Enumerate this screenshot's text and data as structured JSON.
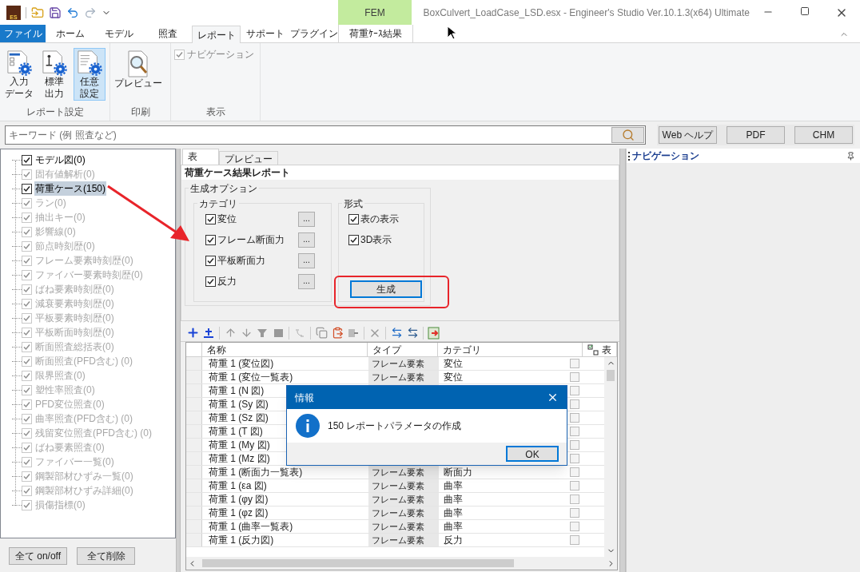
{
  "window": {
    "logo": "ES",
    "context_label": "FEM",
    "title": "BoxCulvert_LoadCase_LSD.esx - Engineer's Studio Ver.10.1.3(x64) Ultimate"
  },
  "ribbon_tabs": [
    {
      "label": "ファイル",
      "kind": "file",
      "selected": false
    },
    {
      "label": "ホーム",
      "kind": "tab",
      "selected": false
    },
    {
      "label": "モデル",
      "kind": "tab",
      "selected": false
    },
    {
      "label": "照査",
      "kind": "tab",
      "selected": false
    },
    {
      "label": "レポート",
      "kind": "tab",
      "selected": true
    },
    {
      "label": "サポート",
      "kind": "tab",
      "selected": false
    },
    {
      "label": "プラグイン",
      "kind": "tab",
      "selected": false
    },
    {
      "label": "荷重ｹｰｽ結果",
      "kind": "context",
      "selected": false
    }
  ],
  "ribbon_groups": [
    {
      "label": "レポート設定",
      "items": [
        {
          "kind": "large",
          "lines": [
            "入力",
            "データ"
          ],
          "selected": false
        },
        {
          "kind": "large",
          "lines": [
            "標準",
            "出力"
          ],
          "selected": false
        },
        {
          "kind": "large",
          "lines": [
            "任意",
            "設定"
          ],
          "selected": true
        }
      ]
    },
    {
      "label": "印刷",
      "items": [
        {
          "kind": "large",
          "lines": [
            "プレビュー"
          ],
          "selected": false
        }
      ]
    },
    {
      "label": "表示",
      "items": [
        {
          "kind": "check",
          "label": "ナビゲーション",
          "checked": true,
          "disabled": true
        }
      ]
    }
  ],
  "search": {
    "placeholder": "キーワード (例 照査など)"
  },
  "help_buttons": [
    "Web ヘルプ",
    "PDF",
    "CHM"
  ],
  "tree": [
    {
      "label": "モデル図(0)",
      "checked": true,
      "disabled": false,
      "selected": false
    },
    {
      "label": "固有値解析(0)",
      "checked": true,
      "disabled": true,
      "selected": false
    },
    {
      "label": "荷重ケース(150)",
      "checked": true,
      "disabled": false,
      "selected": true
    },
    {
      "label": "ラン(0)",
      "checked": true,
      "disabled": true,
      "selected": false
    },
    {
      "label": "抽出キー(0)",
      "checked": true,
      "disabled": true,
      "selected": false
    },
    {
      "label": "影響線(0)",
      "checked": true,
      "disabled": true,
      "selected": false
    },
    {
      "label": "節点時刻歴(0)",
      "checked": true,
      "disabled": true,
      "selected": false
    },
    {
      "label": "フレーム要素時刻歴(0)",
      "checked": true,
      "disabled": true,
      "selected": false
    },
    {
      "label": "ファイバー要素時刻歴(0)",
      "checked": true,
      "disabled": true,
      "selected": false
    },
    {
      "label": "ばね要素時刻歴(0)",
      "checked": true,
      "disabled": true,
      "selected": false
    },
    {
      "label": "減衰要素時刻歴(0)",
      "checked": true,
      "disabled": true,
      "selected": false
    },
    {
      "label": "平板要素時刻歴(0)",
      "checked": true,
      "disabled": true,
      "selected": false
    },
    {
      "label": "平板断面時刻歴(0)",
      "checked": true,
      "disabled": true,
      "selected": false
    },
    {
      "label": "断面照査総括表(0)",
      "checked": true,
      "disabled": true,
      "selected": false
    },
    {
      "label": "断面照査(PFD含む) (0)",
      "checked": true,
      "disabled": true,
      "selected": false
    },
    {
      "label": "限界照査(0)",
      "checked": true,
      "disabled": true,
      "selected": false
    },
    {
      "label": "塑性率照査(0)",
      "checked": true,
      "disabled": true,
      "selected": false
    },
    {
      "label": "PFD変位照査(0)",
      "checked": true,
      "disabled": true,
      "selected": false
    },
    {
      "label": "曲率照査(PFD含む) (0)",
      "checked": true,
      "disabled": true,
      "selected": false
    },
    {
      "label": "残留変位照査(PFD含む) (0)",
      "checked": true,
      "disabled": true,
      "selected": false
    },
    {
      "label": "ばね要素照査(0)",
      "checked": true,
      "disabled": true,
      "selected": false
    },
    {
      "label": "ファイバー一覧(0)",
      "checked": true,
      "disabled": true,
      "selected": false
    },
    {
      "label": "鋼製部材ひずみ一覧(0)",
      "checked": true,
      "disabled": true,
      "selected": false
    },
    {
      "label": "鋼製部材ひずみ詳細(0)",
      "checked": true,
      "disabled": true,
      "selected": false
    },
    {
      "label": "損傷指標(0)",
      "checked": true,
      "disabled": true,
      "selected": false
    }
  ],
  "tree_buttons": [
    "全て on/off",
    "全て削除"
  ],
  "center_tabs": [
    {
      "label": "表",
      "selected": true
    },
    {
      "label": "プレビュー",
      "selected": false
    }
  ],
  "report": {
    "title": "荷重ケース結果レポート",
    "options_label": "生成オプション",
    "category": {
      "label": "カテゴリ",
      "items": [
        {
          "label": "変位",
          "checked": true,
          "button": "..."
        },
        {
          "label": "フレーム断面力",
          "checked": true,
          "button": "..."
        },
        {
          "label": "平板断面力",
          "checked": true,
          "button": "..."
        },
        {
          "label": "反力",
          "checked": true,
          "button": "..."
        }
      ]
    },
    "format": {
      "label": "形式",
      "items": [
        {
          "label": "表の表示",
          "checked": true
        },
        {
          "label": "3D表示",
          "checked": true
        }
      ]
    },
    "generate_button": "生成"
  },
  "table": {
    "columns": [
      "名称",
      "タイプ",
      "カテゴリ",
      "表"
    ],
    "rows": [
      {
        "name": "荷重 1 (変位図)",
        "type": "フレーム要素",
        "category": "変位"
      },
      {
        "name": "荷重 1 (変位一覧表)",
        "type": "フレーム要素",
        "category": "変位"
      },
      {
        "name": "荷重 1 (N 図)"
      },
      {
        "name": "荷重 1 (Sy 図)"
      },
      {
        "name": "荷重 1 (Sz 図)"
      },
      {
        "name": "荷重 1 (T 図)"
      },
      {
        "name": "荷重 1 (My 図)"
      },
      {
        "name": "荷重 1 (Mz 図)"
      },
      {
        "name": "荷重 1 (断面力一覧表)",
        "type": "フレーム要素",
        "category": "断面力"
      },
      {
        "name": "荷重 1 (εa 図)",
        "type": "フレーム要素",
        "category": "曲率"
      },
      {
        "name": "荷重 1 (φy 図)",
        "type": "フレーム要素",
        "category": "曲率"
      },
      {
        "name": "荷重 1 (φz 図)",
        "type": "フレーム要素",
        "category": "曲率"
      },
      {
        "name": "荷重 1 (曲率一覧表)",
        "type": "フレーム要素",
        "category": "曲率"
      },
      {
        "name": "荷重 1 (反力図)",
        "type": "フレーム要素",
        "category": "反力"
      }
    ]
  },
  "dialog": {
    "title": "情報",
    "message": "150 レポートパラメータの作成",
    "button": "OK"
  },
  "navigation_panel": {
    "title": "ナビゲーション"
  }
}
